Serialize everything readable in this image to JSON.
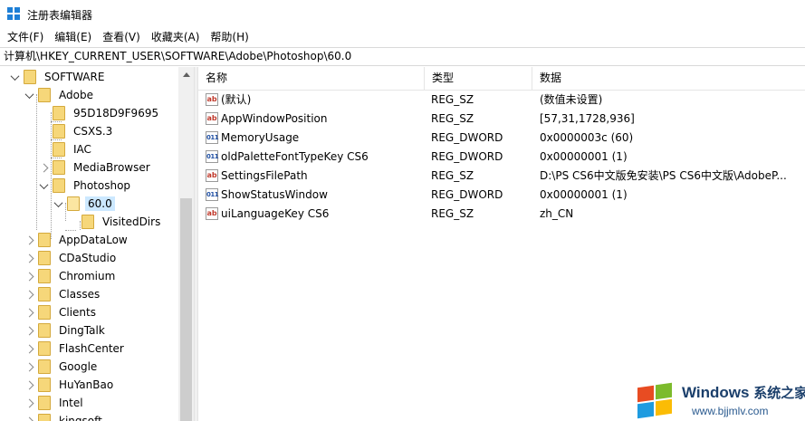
{
  "window": {
    "title": "注册表编辑器"
  },
  "menu": [
    {
      "label": "文件(F)"
    },
    {
      "label": "编辑(E)"
    },
    {
      "label": "查看(V)"
    },
    {
      "label": "收藏夹(A)"
    },
    {
      "label": "帮助(H)"
    }
  ],
  "address": "计算机\\HKEY_CURRENT_USER\\SOFTWARE\\Adobe\\Photoshop\\60.0",
  "tree": [
    {
      "label": "SOFTWARE",
      "level": 0,
      "state": "expanded"
    },
    {
      "label": "Adobe",
      "level": 1,
      "state": "expanded"
    },
    {
      "label": "95D18D9F9695",
      "level": 2,
      "state": "none"
    },
    {
      "label": "CSXS.3",
      "level": 2,
      "state": "none"
    },
    {
      "label": "IAC",
      "level": 2,
      "state": "none"
    },
    {
      "label": "MediaBrowser",
      "level": 2,
      "state": "collapsed"
    },
    {
      "label": "Photoshop",
      "level": 2,
      "state": "expanded"
    },
    {
      "label": "60.0",
      "level": 3,
      "state": "expanded",
      "selected": true
    },
    {
      "label": "VisitedDirs",
      "level": 4,
      "state": "none"
    },
    {
      "label": "AppDataLow",
      "level": 1,
      "state": "collapsed"
    },
    {
      "label": "CDaStudio",
      "level": 1,
      "state": "collapsed"
    },
    {
      "label": "Chromium",
      "level": 1,
      "state": "collapsed"
    },
    {
      "label": "Classes",
      "level": 1,
      "state": "collapsed"
    },
    {
      "label": "Clients",
      "level": 1,
      "state": "collapsed"
    },
    {
      "label": "DingTalk",
      "level": 1,
      "state": "collapsed"
    },
    {
      "label": "FlashCenter",
      "level": 1,
      "state": "collapsed"
    },
    {
      "label": "Google",
      "level": 1,
      "state": "collapsed"
    },
    {
      "label": "HuYanBao",
      "level": 1,
      "state": "collapsed"
    },
    {
      "label": "Intel",
      "level": 1,
      "state": "collapsed"
    },
    {
      "label": "kingsoft",
      "level": 1,
      "state": "collapsed"
    }
  ],
  "columns": {
    "name": "名称",
    "type": "类型",
    "data": "数据"
  },
  "values": [
    {
      "icon": "string-value-icon",
      "glyph": "ab",
      "name": "(默认)",
      "type": "REG_SZ",
      "data": "(数值未设置)"
    },
    {
      "icon": "string-value-icon",
      "glyph": "ab",
      "name": "AppWindowPosition",
      "type": "REG_SZ",
      "data": "[57,31,1728,936]"
    },
    {
      "icon": "binary-value-icon",
      "glyph": "011",
      "name": "MemoryUsage",
      "type": "REG_DWORD",
      "data": "0x0000003c (60)"
    },
    {
      "icon": "binary-value-icon",
      "glyph": "011",
      "name": "oldPaletteFontTypeKey CS6",
      "type": "REG_DWORD",
      "data": "0x00000001 (1)"
    },
    {
      "icon": "string-value-icon",
      "glyph": "ab",
      "name": "SettingsFilePath",
      "type": "REG_SZ",
      "data": "D:\\PS CS6中文版免安装\\PS CS6中文版\\AdobeP..."
    },
    {
      "icon": "binary-value-icon",
      "glyph": "011",
      "name": "ShowStatusWindow",
      "type": "REG_DWORD",
      "data": "0x00000001 (1)"
    },
    {
      "icon": "string-value-icon",
      "glyph": "ab",
      "name": "uiLanguageKey CS6",
      "type": "REG_SZ",
      "data": "zh_CN"
    }
  ],
  "watermark": {
    "brand": "Windows",
    "brand_cn": "系统之家",
    "url": "www.bjjmlv.com"
  },
  "colors": {
    "selection": "#cce8ff",
    "folder": "#f6d77a",
    "accent": "#1e7fd6"
  }
}
